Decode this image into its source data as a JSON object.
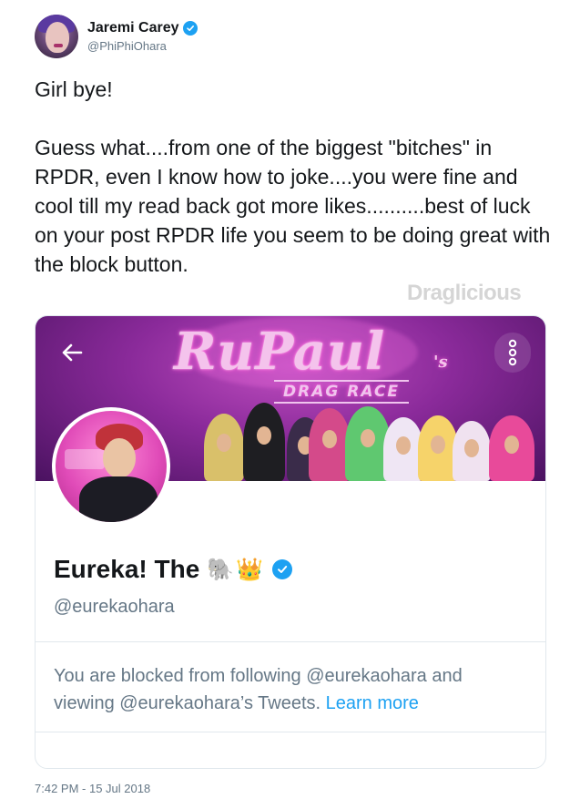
{
  "author": {
    "name": "Jaremi Carey",
    "handle": "@PhiPhiOhara",
    "verified": true
  },
  "tweet": {
    "line1": "Girl bye!",
    "line2": "Guess what....from one of the biggest \"bitches\" in RPDR, even I know how to joke....you were fine and cool till my read back got more likes..........best of luck on your post RPDR life you seem to be doing great with the block button.",
    "timestamp": "7:42 PM - 15 Jul 2018"
  },
  "watermark": "Draglicious",
  "embedded_profile": {
    "banner": {
      "logo": "RuPaul",
      "logo_suffix": "'s",
      "subtitle": "DRAG RACE"
    },
    "back_icon": "arrow-left-icon",
    "more_icon": "vertical-dots-icon",
    "display_name": "Eureka! The",
    "name_emojis": [
      "🐘",
      "👑"
    ],
    "verified": true,
    "handle": "@eurekaohara",
    "blocked_message_prefix": "You are blocked from following @eurekaohara and viewing @eurekaohara’s Tweets.",
    "learn_more": "Learn more"
  },
  "colors": {
    "link": "#1da1f2",
    "secondary_text": "#657786",
    "banner_purple": "#8a2a9a"
  }
}
